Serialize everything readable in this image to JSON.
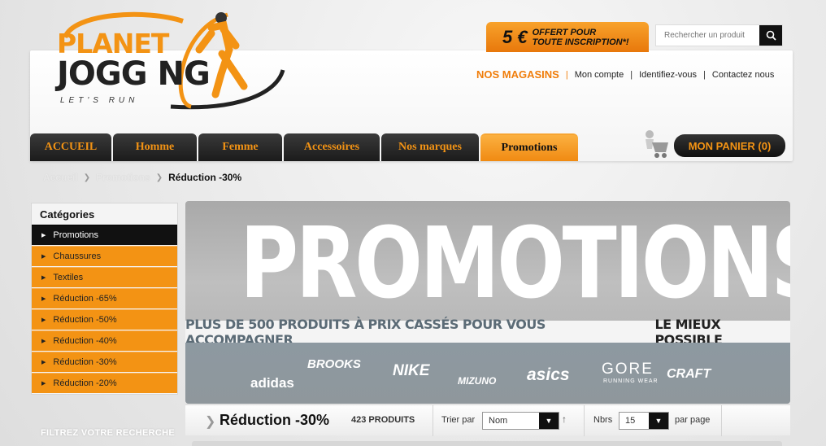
{
  "logo": {
    "line1": "PLANET",
    "line2": "JOGG NG",
    "tagline": "LET'S RUN"
  },
  "promo_badge": {
    "amount": "5 €",
    "line1": "OFFERT POUR",
    "line2": "TOUTE INSCRIPTION*!"
  },
  "search": {
    "placeholder": "Rechercher un produit",
    "button_icon": "search-icon"
  },
  "top_links": {
    "stores": "NOS MAGASINS",
    "account": "Mon compte",
    "login": "Identifiez-vous",
    "contact": "Contactez nous"
  },
  "nav": {
    "items": [
      "ACCUEIL",
      "Homme",
      "Femme",
      "Accessoires",
      "Nos marques",
      "Promotions"
    ],
    "active": "Promotions"
  },
  "cart": {
    "label": "MON PANIER (0)",
    "icon": "cart-icon"
  },
  "breadcrumb": {
    "items": [
      "Accueil",
      "Promotions"
    ],
    "current": "Réduction -30%"
  },
  "sidebar": {
    "title": "Catégories",
    "items": [
      "Promotions",
      "Chaussures",
      "Textiles",
      "Réduction -65%",
      "Réduction -50%",
      "Réduction -40%",
      "Réduction -30%",
      "Réduction -20%"
    ],
    "active": "Promotions"
  },
  "filter": {
    "title": "FILTREZ VOTRE RECHERCHE"
  },
  "banner": {
    "title": "PROMOTIONS",
    "subtitle_main": "PLUS DE 500 PRODUITS À PRIX CASSÉS POUR VOUS ACCOMPAGNER",
    "subtitle_emphasis": "LE MIEUX POSSIBLE",
    "brands": [
      "adidas",
      "BROOKS",
      "NIKE",
      "MIZUNO",
      "asics",
      "GORE",
      "RUNNING WEAR",
      "CRAFT"
    ]
  },
  "toolbar": {
    "title": "Réduction -30%",
    "count": "423 PRODUITS",
    "sort_label": "Trier par",
    "sort_value": "Nom",
    "per_label": "Nbrs",
    "per_value": "15",
    "per_suffix": "par page"
  },
  "colors": {
    "brand_orange": "#f39314",
    "dark": "#1b1b1b"
  }
}
